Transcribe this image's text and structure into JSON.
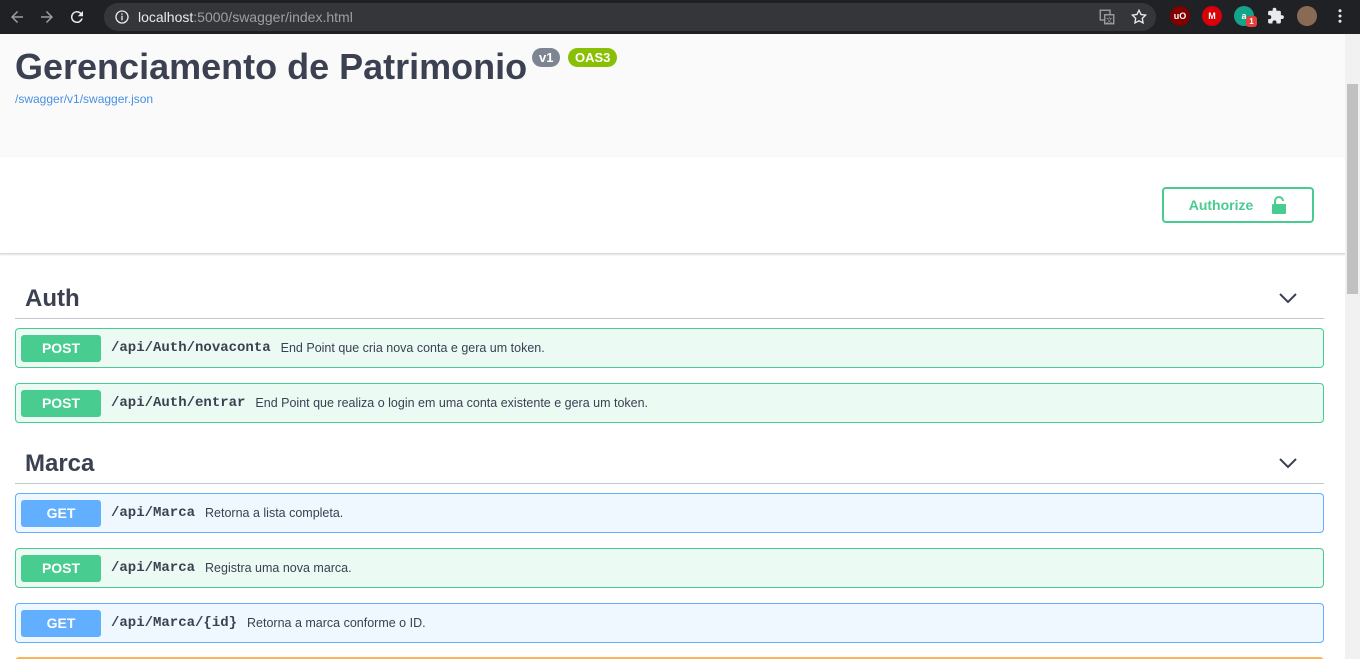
{
  "browser": {
    "url_host": "localhost",
    "url_rest": ":5000/swagger/index.html"
  },
  "info": {
    "title": "Gerenciamento de Patrimonio",
    "version_badge": "v1",
    "oas_badge": "OAS3",
    "spec_link": "/swagger/v1/swagger.json"
  },
  "scheme": {
    "authorize_label": "Authorize"
  },
  "tags": [
    {
      "name": "Auth",
      "operations": [
        {
          "method": "POST",
          "path": "/api/Auth/novaconta",
          "summary": "End Point que cria nova conta e gera um token."
        },
        {
          "method": "POST",
          "path": "/api/Auth/entrar",
          "summary": "End Point que realiza o login em uma conta existente e gera um token."
        }
      ]
    },
    {
      "name": "Marca",
      "operations": [
        {
          "method": "GET",
          "path": "/api/Marca",
          "summary": "Retorna a lista completa."
        },
        {
          "method": "POST",
          "path": "/api/Marca",
          "summary": "Registra uma nova marca."
        },
        {
          "method": "GET",
          "path": "/api/Marca/{id}",
          "summary": "Retorna a marca conforme o ID."
        }
      ]
    }
  ],
  "colors": {
    "post": "#49cc90",
    "get": "#61affe",
    "put": "#fca130",
    "text": "#3b4151"
  }
}
